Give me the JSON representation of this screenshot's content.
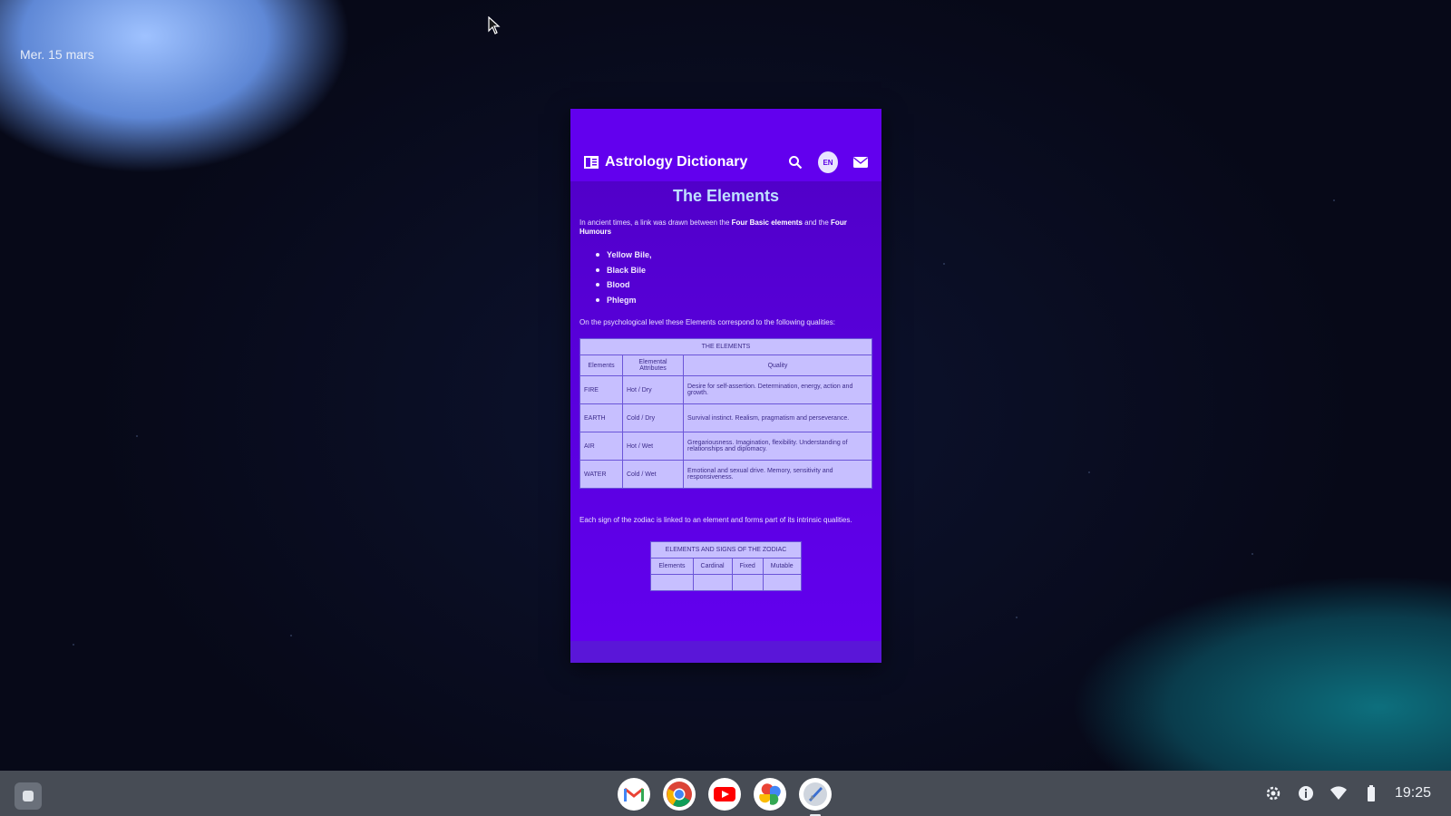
{
  "desktop": {
    "date_label": "Mer. 15 mars"
  },
  "app": {
    "title": "Astrology Dictionary",
    "lang_badge": "EN",
    "page_heading": "The Elements",
    "intro_text_before": "In ancient times, a link was drawn between the ",
    "intro_bold_1": "Four Basic elements",
    "intro_text_mid": " and the ",
    "intro_bold_2": "Four Humours",
    "humours": [
      "Yellow Bile,",
      "Black Bile",
      "Blood",
      "Phlegm"
    ],
    "qualities_text": "On the psychological level these Elements correspond to the following qualities:",
    "elements_table": {
      "caption": "THE ELEMENTS",
      "headers": [
        "Elements",
        "Elemental Attributes",
        "Quality"
      ],
      "rows": [
        [
          "FIRE",
          "Hot / Dry",
          "Desire for self-assertion. Determination, energy, action and growth."
        ],
        [
          "EARTH",
          "Cold / Dry",
          "Survival instinct. Realism, pragmatism and perseverance."
        ],
        [
          "AIR",
          "Hot / Wet",
          "Gregariousness. Imagination, flexibility. Understanding of relationships and diplomacy."
        ],
        [
          "WATER",
          "Cold / Wet",
          "Emotional and sexual drive. Memory, sensitivity and responsiveness."
        ]
      ]
    },
    "zodiac_text": "Each sign of the zodiac is linked to an element and forms part of its intrinsic qualities.",
    "signs_table": {
      "caption": "ELEMENTS AND SIGNS OF THE ZODIAC",
      "headers": [
        "Elements",
        "Cardinal",
        "Fixed",
        "Mutable"
      ]
    }
  },
  "shelf": {
    "apps": [
      {
        "name": "Gmail",
        "icon": "gmail-icon"
      },
      {
        "name": "Chrome",
        "icon": "chrome-icon"
      },
      {
        "name": "YouTube",
        "icon": "youtube-icon"
      },
      {
        "name": "Photos",
        "icon": "photos-icon"
      },
      {
        "name": "Astrology Dictionary",
        "icon": "astrology-app-icon"
      }
    ],
    "clock": "19:25"
  },
  "colors": {
    "app_purple": "#6200ee",
    "shelf_bg": "#474c55",
    "table_bg": "#c7bfff"
  }
}
